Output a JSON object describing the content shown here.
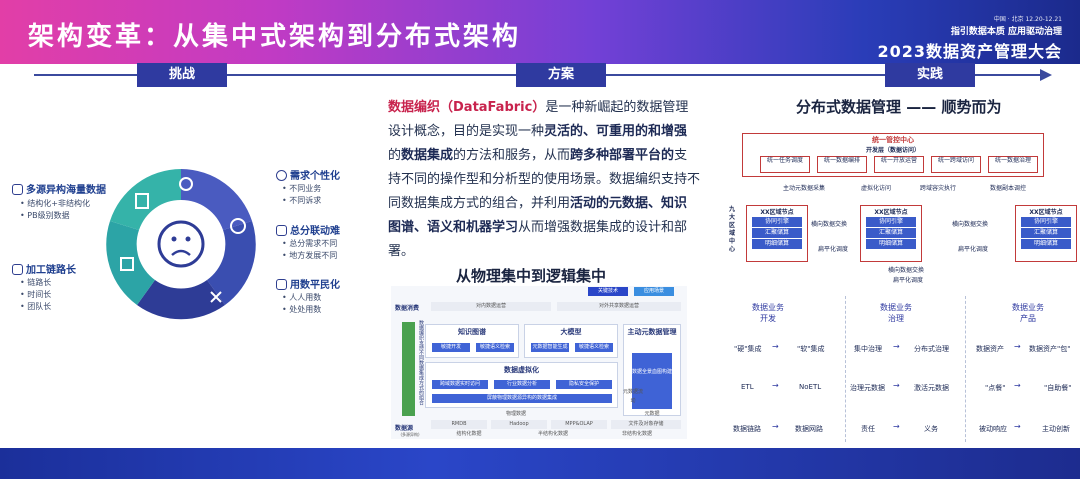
{
  "header": {
    "title": "架构变革：从集中式架构到分布式架构",
    "conf_small": "中国 · 北京   12.20-12.21",
    "conf_tag": "指引数据本质  应用驱动治理",
    "conf_name": "2023数据资产管理大会"
  },
  "stages": [
    "挑战",
    "方案",
    "实践"
  ],
  "left": {
    "items": [
      {
        "head": "多源异构海量数据",
        "subs": [
          "• 结构化+非结构化",
          "• PB级别数据"
        ]
      },
      {
        "head": "加工链路长",
        "subs": [
          "• 链路长",
          "• 时间长",
          "• 团队长"
        ]
      },
      {
        "head": "需求个性化",
        "subs": [
          "• 不同业务",
          "• 不同诉求"
        ]
      },
      {
        "head": "总分联动难",
        "subs": [
          "• 总分需求不同",
          "• 地方发展不同"
        ]
      },
      {
        "head": "用数平民化",
        "subs": [
          "• 人人用数",
          "• 处处用数"
        ]
      }
    ]
  },
  "middle": {
    "p1_red": "数据编织（DataFabric）",
    "p1_a": "是一种新崛起的数据管理设计概念，目的是实现一种",
    "p1_b1": "灵活的、可重用的和增强",
    "p1_c": "的",
    "p1_b2": "数据集成",
    "p1_d": "的方法和服务，从而",
    "p1_b3": "跨多种部署平台的",
    "p1_e": "支持不同的操作型和分析型的使用场景。数据编织支持不同数据集成方式的组合，并利用",
    "p1_b4": "活动的元数据、知识图谱、语义和机器学习",
    "p1_f": "从而增强数据集成的设计和部署。",
    "subtitle": "从物理集中到逻辑集中",
    "diagram": {
      "legend_a": "关键技术",
      "legend_b": "应用场景",
      "consume": "数据消费",
      "consume_a": "对内数据运营",
      "consume_b": "对外共享数据运营",
      "left_bar": "数据编织支持不同数据集成方式的组合",
      "kg": "知识图谱",
      "kg_a": "敏捷开发",
      "kg_b": "敏捷语义检索",
      "llm": "大模型",
      "llm_a": "元数据智能生成",
      "llm_b": "敏捷语义检索",
      "mdm": "主动元数据管理",
      "mdm_a": "数据全景血图构建",
      "virt": "数据虚拟化",
      "virt_a": "跨域数据实时访问",
      "virt_b": "行业数据分析",
      "virt_c": "隐私安全保护",
      "virt_d": "屏蔽物理数据源异构的数据集成",
      "phys": "物理数据",
      "source": "数据源",
      "source_sub": "(多源异构)",
      "src_a": "RMDB",
      "src_b": "Hadoop",
      "src_c": "MPP&OLAP",
      "src_d": "文件及对象存储",
      "src_e": "结构化数据",
      "src_f": "半结构化数据",
      "src_g": "非结构化数据",
      "meta": "元数据",
      "flow": "元数据流动"
    }
  },
  "right": {
    "title": "分布式数据管理 —— 顺势而为",
    "center": "统一管控中心",
    "center_sub": "开发层（数据访问）",
    "ops": [
      "统一任务调度",
      "统一数据编排",
      "统一开放运营",
      "统一跨域访问",
      "统一数据治理"
    ],
    "links": [
      "主动元数据采集",
      "虚拟化访问",
      "跨域容灾执行",
      "数据副本调控"
    ],
    "side": "九大区域中心",
    "node": "XX区域节点",
    "node_items": [
      "协同引擎",
      "汇聚储算",
      "明细储算"
    ],
    "node_links": [
      "横向数据交换",
      "扁平化调度"
    ],
    "bottom_links": [
      "横向数据交换",
      "扁平化调度"
    ],
    "cols": [
      {
        "cap": [
          "数据业务",
          "开发"
        ],
        "rows": [
          [
            "\"硬\"集成",
            "\"软\"集成"
          ],
          [
            "ETL",
            "NoETL"
          ],
          [
            "数据链路",
            "数据网路"
          ]
        ]
      },
      {
        "cap": [
          "数据业务",
          "治理"
        ],
        "rows": [
          [
            "集中治理",
            "分布式治理"
          ],
          [
            "治理元数据",
            "激活元数据"
          ],
          [
            "责任",
            "义务"
          ]
        ]
      },
      {
        "cap": [
          "数据业务",
          "产品"
        ],
        "rows": [
          [
            "数据资产",
            "数据资产\"包\""
          ],
          [
            "\"点餐\"",
            "\"自助餐\""
          ],
          [
            "被动响应",
            "主动创新"
          ]
        ]
      }
    ]
  },
  "colors": {
    "accent": "#2f3aa0",
    "red": "#c8234d"
  }
}
